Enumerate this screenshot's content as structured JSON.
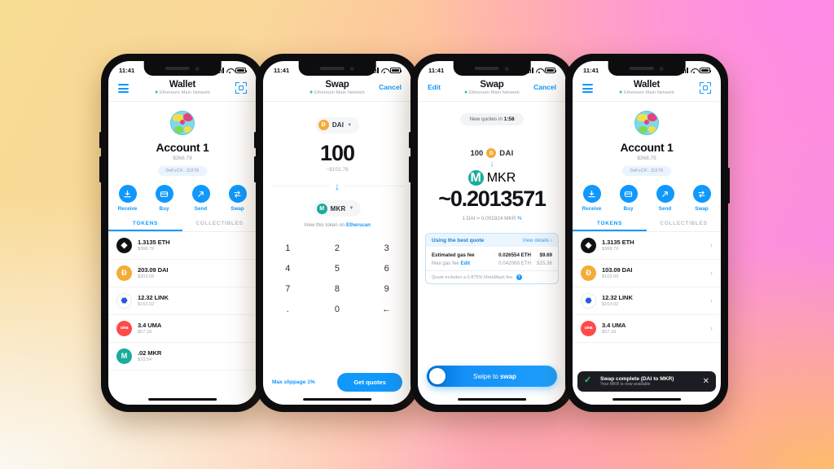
{
  "background": {
    "gradient_from": "#f7dc93",
    "gradient_mid": "#ffb9a0",
    "gradient_to": "#f78ae6",
    "accent_blue": "#1098fc"
  },
  "phones": [
    {
      "id": "phone-wallet-left",
      "screen": "wallet",
      "status": {
        "time": "11:41"
      },
      "header": {
        "title": "Wallet",
        "subtitle": "Ethereum Main Network",
        "left_icon": "hamburger-menu-icon",
        "right_icon": "scan-qr-icon"
      },
      "account": {
        "name": "Account 1",
        "balance": "$368.79",
        "address": "0xFcCF...D276"
      },
      "actions": [
        {
          "label": "Receive",
          "icon": "download-arrow-icon"
        },
        {
          "label": "Buy",
          "icon": "card-icon"
        },
        {
          "label": "Send",
          "icon": "send-arrow-icon"
        },
        {
          "label": "Swap",
          "icon": "swap-arrows-icon"
        }
      ],
      "tabs": [
        {
          "label": "TOKENS",
          "active": true
        },
        {
          "label": "COLLECTIBLES",
          "active": false
        }
      ],
      "tokens": [
        {
          "symbol": "ETH",
          "amount": "1.3135 ETH",
          "fiat": "$368.79",
          "color": "#111111",
          "glyph": "⧫"
        },
        {
          "symbol": "DAI",
          "amount": "203.09 DAI",
          "fiat": "$203.09",
          "color": "#f5ac37",
          "glyph": "Đ"
        },
        {
          "symbol": "LINK",
          "amount": "12.32 LINK",
          "fiat": "$163.02",
          "color": "#ffffff",
          "glyph": "⬣"
        },
        {
          "symbol": "UMA",
          "amount": "3.4 UMA",
          "fiat": "$57.18",
          "color": "#ff4a4a",
          "glyph": "uma"
        },
        {
          "symbol": "MKR",
          "amount": ".02 MKR",
          "fiat": "$10.54",
          "color": "#1aab9b",
          "glyph": "M"
        }
      ]
    },
    {
      "id": "phone-swap-amount",
      "screen": "swap-amount",
      "status": {
        "time": "11:41"
      },
      "header": {
        "title": "Swap",
        "subtitle": "Ethereum Main Network",
        "right_link": "Cancel"
      },
      "from_token": {
        "symbol": "DAI",
        "color": "#f5ac37",
        "glyph": "Đ"
      },
      "amount": "100",
      "amount_fiat": "~$102.78",
      "to_token": {
        "symbol": "MKR",
        "color": "#1aab9b",
        "glyph": "M"
      },
      "etherscan_text": "View this token on ",
      "etherscan_link": "Etherscan",
      "keypad": [
        "1",
        "2",
        "3",
        "4",
        "5",
        "6",
        "7",
        "8",
        "9",
        ".",
        "0",
        "←"
      ],
      "slippage_label": "Max slippage 1%",
      "cta_label": "Get quotes"
    },
    {
      "id": "phone-swap-quote",
      "screen": "swap-quote",
      "status": {
        "time": "11:41"
      },
      "header": {
        "title": "Swap",
        "subtitle": "Ethereum Main Network",
        "left_link": "Edit",
        "right_link": "Cancel"
      },
      "quote_timer_prefix": "New quotes in ",
      "quote_timer_value": "1:58",
      "from_amount": "100",
      "from_token": {
        "symbol": "DAI",
        "color": "#f5ac37",
        "glyph": "Đ"
      },
      "to_token": {
        "symbol": "MKR",
        "color": "#1aab9b",
        "glyph": "M"
      },
      "to_amount": "~0.2013571",
      "rate": "1 DAI = 0.001924 MKR",
      "quote_card": {
        "title": "Using the best quote",
        "view_details": "View details ›",
        "rows": [
          {
            "label": "Estimated gas fee",
            "eth": "0.026554 ETH",
            "fiat": "$9.69",
            "strong": true
          },
          {
            "label": "Max gas fee",
            "edit": "Edit",
            "eth": "0.042089 ETH",
            "fiat": "$15.36",
            "strong": false
          }
        ],
        "note": "Quote includes a 0.875% MetaMask fee."
      },
      "swipe_text_plain": "Swipe to ",
      "swipe_text_bold": "swap"
    },
    {
      "id": "phone-wallet-right",
      "screen": "wallet-complete",
      "status": {
        "time": "11:41"
      },
      "header": {
        "title": "Wallet",
        "subtitle": "Ethereum Main Network",
        "left_icon": "hamburger-menu-icon",
        "right_icon": "scan-qr-icon"
      },
      "account": {
        "name": "Account 1",
        "balance": "$368.79",
        "address": "0xFcCF...D276"
      },
      "actions": [
        {
          "label": "Receive",
          "icon": "download-arrow-icon"
        },
        {
          "label": "Buy",
          "icon": "card-icon"
        },
        {
          "label": "Send",
          "icon": "send-arrow-icon"
        },
        {
          "label": "Swap",
          "icon": "swap-arrows-icon"
        }
      ],
      "tabs": [
        {
          "label": "TOKENS",
          "active": true
        },
        {
          "label": "COLLECTIBLES",
          "active": false
        }
      ],
      "tokens": [
        {
          "symbol": "ETH",
          "amount": "1.3135 ETH",
          "fiat": "$368.79",
          "color": "#111111",
          "glyph": "⧫"
        },
        {
          "symbol": "DAI",
          "amount": "103.09 DAI",
          "fiat": "$103.09",
          "color": "#f5ac37",
          "glyph": "Đ"
        },
        {
          "symbol": "LINK",
          "amount": "12.32 LINK",
          "fiat": "$163.02",
          "color": "#ffffff",
          "glyph": "⬣"
        },
        {
          "symbol": "UMA",
          "amount": "3.4 UMA",
          "fiat": "$57.18",
          "color": "#ff4a4a",
          "glyph": "uma"
        }
      ],
      "toast": {
        "title": "Swap complete (DAI to MKR)",
        "subtitle": "Your MKR is now available",
        "icon": "check-circle-icon",
        "close_icon": "close-icon"
      }
    }
  ]
}
